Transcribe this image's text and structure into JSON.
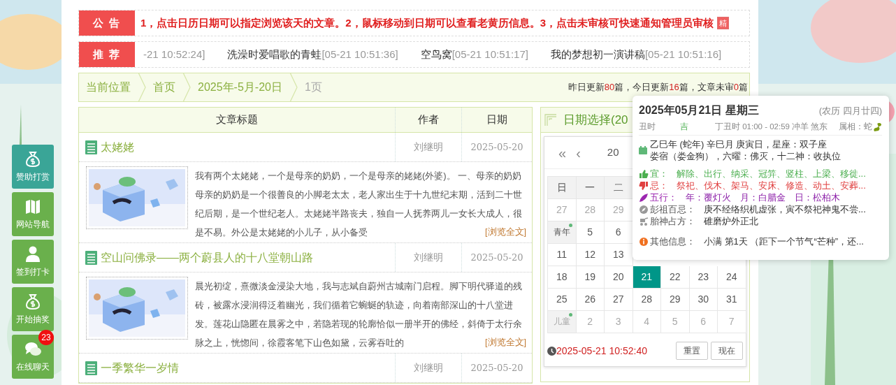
{
  "notice": {
    "label": "公 告",
    "text": "1，点击日历日期可以指定浏览该天的文章。2，鼠标移动到日期可以查看老黄历信息。3，点击未审核可快速通知管理员审核",
    "badge": "精"
  },
  "recommend": {
    "label": "推 荐",
    "items": [
      {
        "time": "-21 10:52:24]"
      },
      {
        "title": "洗澡时爱唱歌的青蛙",
        "time": "[05-21 10:51:36]"
      },
      {
        "title": "空鸟窝",
        "time": "[05-21 10:51:17]"
      },
      {
        "title": "我的梦想初一演讲稿",
        "time": "[05-21 10:51:16]"
      }
    ]
  },
  "breadcrumb": {
    "items": [
      {
        "label": "当前位置",
        "kind": "label"
      },
      {
        "label": "首页",
        "kind": "link"
      },
      {
        "label": "2025年-5月-20日",
        "kind": "link"
      },
      {
        "label": "1页",
        "kind": "page"
      }
    ],
    "stats": [
      {
        "prefix": "昨日更新",
        "count": "80",
        "suffix": "篇，"
      },
      {
        "prefix": "今日更新",
        "count": "16",
        "suffix": "篇，"
      },
      {
        "prefix": "文章未审",
        "count": "0",
        "suffix": "篇"
      }
    ]
  },
  "articles": {
    "columns": [
      "文章标题",
      "作者",
      "日期"
    ],
    "rows": [
      {
        "title": "太姥姥",
        "author": "刘继明",
        "date": "2025-05-20",
        "more": "[浏览全文]",
        "excerpt": "我有两个太姥姥，一个是母亲的奶奶，一个是母亲的姥姥(外婆)。 一、母亲的奶奶母亲的奶奶是一个很善良的小脚老太太，老人家出生于十九世纪末期，活到二十世纪后期，是一个世纪老人。太姥姥半路丧夫，独自一人抚养两儿一女长大成人，很是不易。外公是太姥姥的小儿子，从小备受"
      },
      {
        "title": "空山问佛录——两个蔚县人的十八堂朝山路",
        "author": "刘继明",
        "date": "2025-05-20",
        "more": "[浏览全文]",
        "excerpt": "晨光初绽，熹微淡金浸染大地，我与志斌自蔚州古城南门启程。脚下明代驿道的残砖，被露水浸润得泛着幽光，我们循着它蜿蜒的轨迹，向着南部深山的十八堂进发。莲花山隐匿在晨雾之中，若隐若现的轮廓恰似一册半开的佛经，斜倚于太行余脉之上，恍惚间，徐霞客笔下山色如黛，云雾吞吐的"
      },
      {
        "title": "一季繁华一岁情",
        "author": "刘继明",
        "date": "2025-05-20"
      }
    ]
  },
  "sidebar": [
    {
      "label": "赞助打赏",
      "kind": "money-bag",
      "color": "#3aa597"
    },
    {
      "label": "网站导航",
      "kind": "map",
      "color": "#6ab04c"
    },
    {
      "label": "签到打卡",
      "kind": "user",
      "color": "#6ab04c"
    },
    {
      "label": "开始抽奖",
      "kind": "money-bag",
      "color": "#6ab04c"
    },
    {
      "label": "在线聊天",
      "kind": "chat",
      "color": "#6ab04c",
      "badge": "23"
    }
  ],
  "calendar": {
    "title": "日期选择(20",
    "nav": [
      "«",
      "‹",
      "20"
    ],
    "weekdays": [
      "日",
      "一",
      "二"
    ],
    "weeks": [
      {
        "days": [
          {
            "text": "27",
            "muted": true,
            "selected": false
          },
          {
            "text": "28",
            "muted": true,
            "selected": false
          },
          {
            "text": "29",
            "muted": true,
            "selected": false
          }
        ]
      },
      {
        "days": [
          {
            "text": "青年",
            "muted": false,
            "selected": false,
            "festival": true
          },
          {
            "text": "5",
            "muted": false,
            "selected": false
          },
          {
            "text": "6",
            "muted": false,
            "selected": false
          }
        ]
      },
      {
        "days": [
          {
            "text": "11",
            "muted": false,
            "selected": false
          },
          {
            "text": "12",
            "muted": false,
            "selected": false
          },
          {
            "text": "13",
            "muted": false,
            "selected": false
          }
        ]
      },
      {
        "days": [
          {
            "text": "18",
            "muted": false,
            "selected": false
          },
          {
            "text": "19",
            "muted": false,
            "selected": false
          },
          {
            "text": "20",
            "muted": false,
            "selected": false
          },
          {
            "text": "21",
            "muted": false,
            "selected": true
          },
          {
            "text": "22",
            "muted": false,
            "selected": false
          },
          {
            "text": "23",
            "muted": false,
            "selected": false
          },
          {
            "text": "24",
            "muted": false,
            "selected": false
          }
        ]
      },
      {
        "days": [
          {
            "text": "25",
            "muted": false,
            "selected": false
          },
          {
            "text": "26",
            "muted": false,
            "selected": false
          },
          {
            "text": "27",
            "muted": false,
            "selected": false
          },
          {
            "text": "28",
            "muted": false,
            "selected": false
          },
          {
            "text": "29",
            "muted": false,
            "selected": false
          },
          {
            "text": "30",
            "muted": false,
            "selected": false
          },
          {
            "text": "31",
            "muted": false,
            "selected": false
          }
        ]
      },
      {
        "days": [
          {
            "text": "儿童",
            "muted": true,
            "selected": false,
            "festival": true
          },
          {
            "text": "2",
            "muted": true,
            "selected": false
          },
          {
            "text": "3",
            "muted": true,
            "selected": false
          },
          {
            "text": "4",
            "muted": true,
            "selected": false
          },
          {
            "text": "5",
            "muted": true,
            "selected": false
          },
          {
            "text": "6",
            "muted": true,
            "selected": false
          },
          {
            "text": "7",
            "muted": true,
            "selected": false
          }
        ]
      }
    ],
    "time": "2025-05-21 10:52:40",
    "buttons": [
      "重置",
      "现在"
    ]
  },
  "almanac": {
    "date": "2025年05月21日 星期三",
    "lunar": "(农历 四月廿四)",
    "hour": {
      "name": "丑时",
      "luck": "吉",
      "detail": "丁丑时 01:00 - 02:59 冲羊 煞东",
      "zodiac": "属相：蛇"
    },
    "ganzhi": [
      "乙巳年 (蛇年) 辛巳月 庚寅日，星座：双子座",
      "娄宿（娄金狗），六曜：佛灭，十二神：收执位"
    ],
    "rows": [
      {
        "kind": "yi",
        "label": "宜：",
        "text": "解除、出行、纳采、冠笄、竖柱、上梁、移徙..."
      },
      {
        "kind": "ji",
        "label": "忌：",
        "text": "祭祀、伐木、架马、安床、修造、动土、安葬..."
      },
      {
        "kind": "wuxing",
        "label": "五行：",
        "text": "年：覆灯火　月：白腊金　日：松柏木"
      },
      {
        "kind": "pengzu",
        "label": "彭祖百忌：",
        "text": "庚不经络织机虚张，寅不祭祀神鬼不尝..."
      },
      {
        "kind": "taishen",
        "label": "胎神占方：",
        "text": "碓磨炉外正北"
      },
      {
        "kind": "info",
        "label": "其他信息：",
        "text": "小满 第1天 （距下一个节气“芒种”，还..."
      }
    ]
  }
}
